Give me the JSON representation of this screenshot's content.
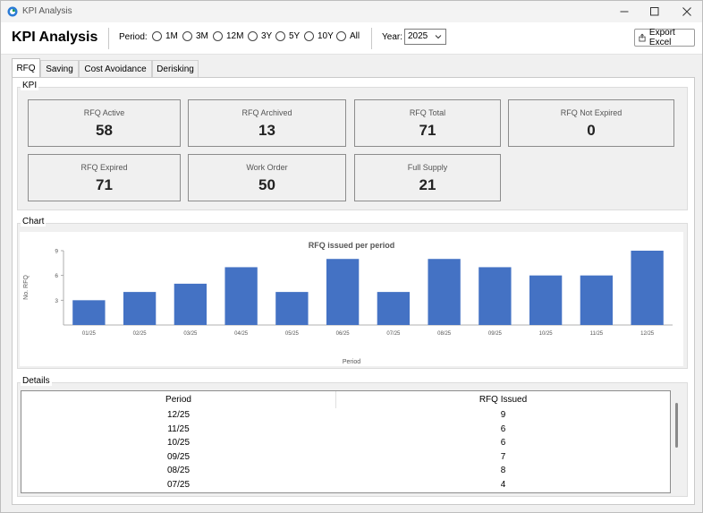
{
  "window": {
    "title": "KPI Analysis"
  },
  "toolbar": {
    "title": "KPI Analysis",
    "period_label": "Period:",
    "period_options": [
      "1M",
      "3M",
      "12M",
      "3Y",
      "5Y",
      "10Y",
      "All"
    ],
    "year_label": "Year:",
    "year_value": "2025",
    "export_label": "Export Excel"
  },
  "tabs": [
    "RFQ",
    "Saving",
    "Cost Avoidance",
    "Derisking"
  ],
  "kpi": {
    "group_label": "KPI",
    "cards": [
      {
        "label": "RFQ Active",
        "value": "58"
      },
      {
        "label": "RFQ Archived",
        "value": "13"
      },
      {
        "label": "RFQ Total",
        "value": "71"
      },
      {
        "label": "RFQ Not Expired",
        "value": "0"
      },
      {
        "label": "RFQ Expired",
        "value": "71"
      },
      {
        "label": "Work Order",
        "value": "50"
      },
      {
        "label": "Full Supply",
        "value": "21"
      }
    ]
  },
  "chart_group_label": "Chart",
  "chart_data": {
    "type": "bar",
    "title": "RFQ issued per period",
    "xlabel": "Period",
    "ylabel": "No. RFQ",
    "categories": [
      "01/25",
      "02/25",
      "03/25",
      "04/25",
      "05/25",
      "06/25",
      "07/25",
      "08/25",
      "09/25",
      "10/25",
      "11/25",
      "12/25"
    ],
    "values": [
      3,
      4,
      5,
      7,
      4,
      8,
      4,
      8,
      7,
      6,
      6,
      9
    ],
    "yticks": [
      3,
      6,
      9
    ],
    "ylim": [
      0,
      9
    ],
    "color": "#4472c4",
    "grid": false
  },
  "details": {
    "group_label": "Details",
    "columns": [
      "Period",
      "RFQ Issued"
    ],
    "rows": [
      [
        "12/25",
        "9"
      ],
      [
        "11/25",
        "6"
      ],
      [
        "10/25",
        "6"
      ],
      [
        "09/25",
        "7"
      ],
      [
        "08/25",
        "8"
      ],
      [
        "07/25",
        "4"
      ]
    ]
  }
}
